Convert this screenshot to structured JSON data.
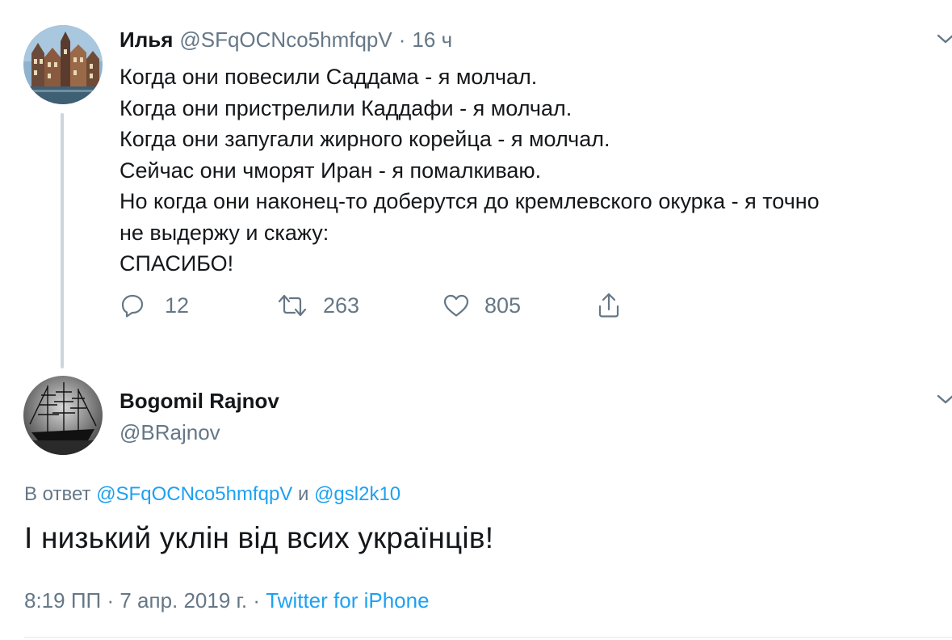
{
  "tweet1": {
    "name": "Илья",
    "handle": "@SFqOCNco5hmfqpV",
    "separator": "·",
    "time": "16 ч",
    "lines": [
      "Когда они повесили Саддама - я молчал.",
      "Когда они пристрелили Каддафи - я молчал.",
      "Когда они запугали жирного корейца - я молчал.",
      "Сейчас они чморят Иран - я помалкиваю.",
      "Но когда они наконец-то доберутся до кремлевского окурка - я точно",
      "не выдержу и скажу:",
      "СПАСИБО!"
    ],
    "actions": {
      "reply_count": "12",
      "retweet_count": "263",
      "like_count": "805"
    }
  },
  "tweet2": {
    "name": "Bogomil Rajnov",
    "handle": "@BRajnov",
    "reply_prefix": "В ответ",
    "reply_to_1": "@SFqOCNco5hmfqpV",
    "reply_and": "и",
    "reply_to_2": "@gsl2k10",
    "text": "І низький уклін від всих українців!",
    "time": "8:19 ПП",
    "separator1": "·",
    "date": "7 апр. 2019 г.",
    "separator2": "·",
    "source": "Twitter for iPhone"
  },
  "icons": {
    "reply": "reply-icon",
    "retweet": "retweet-icon",
    "like": "heart-icon",
    "share": "share-icon",
    "menu": "chevron-down-icon"
  },
  "colors": {
    "text": "#14171a",
    "secondary": "#657786",
    "link": "#1da1f2",
    "thread_line": "#ccd6dd"
  }
}
